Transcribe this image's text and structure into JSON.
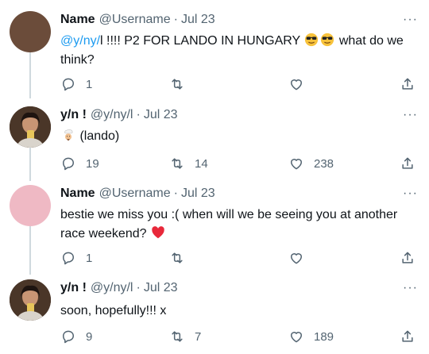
{
  "tweets": [
    {
      "name": "Name",
      "handle": "@Username",
      "sep": "·",
      "date": "Jul 23",
      "text_mention": "@y/ny/",
      "text_pre": "l !!!! P2 FOR LANDO IN HUNGARY",
      "text_post": "what do we think?",
      "emojis": [
        "sunglasses-emoji",
        "sunglasses-emoji"
      ],
      "replies": "1",
      "retweets": "",
      "likes": ""
    },
    {
      "name": "y/n !",
      "handle": "@y/ny/l",
      "sep": "·",
      "date": "Jul 23",
      "text_emoji": "chef-emoji",
      "text": "(lando)",
      "replies": "19",
      "retweets": "14",
      "likes": "238"
    },
    {
      "name": "Name",
      "handle": "@Username",
      "sep": "·",
      "date": "Jul 23",
      "text": "bestie we miss you :( when will we be seeing you at another race weekend?",
      "text_emoji": "red-heart-emoji",
      "replies": "1",
      "retweets": "",
      "likes": ""
    },
    {
      "name": "y/n !",
      "handle": "@y/ny/l",
      "sep": "·",
      "date": "Jul 23",
      "text": "soon, hopefully!!! x",
      "replies": "9",
      "retweets": "7",
      "likes": "189"
    }
  ],
  "more_label": "···",
  "colors": {
    "text": "#0f1419",
    "secondary": "#536471",
    "mention": "#1d9bf0",
    "thread_line": "#cfd9de"
  }
}
